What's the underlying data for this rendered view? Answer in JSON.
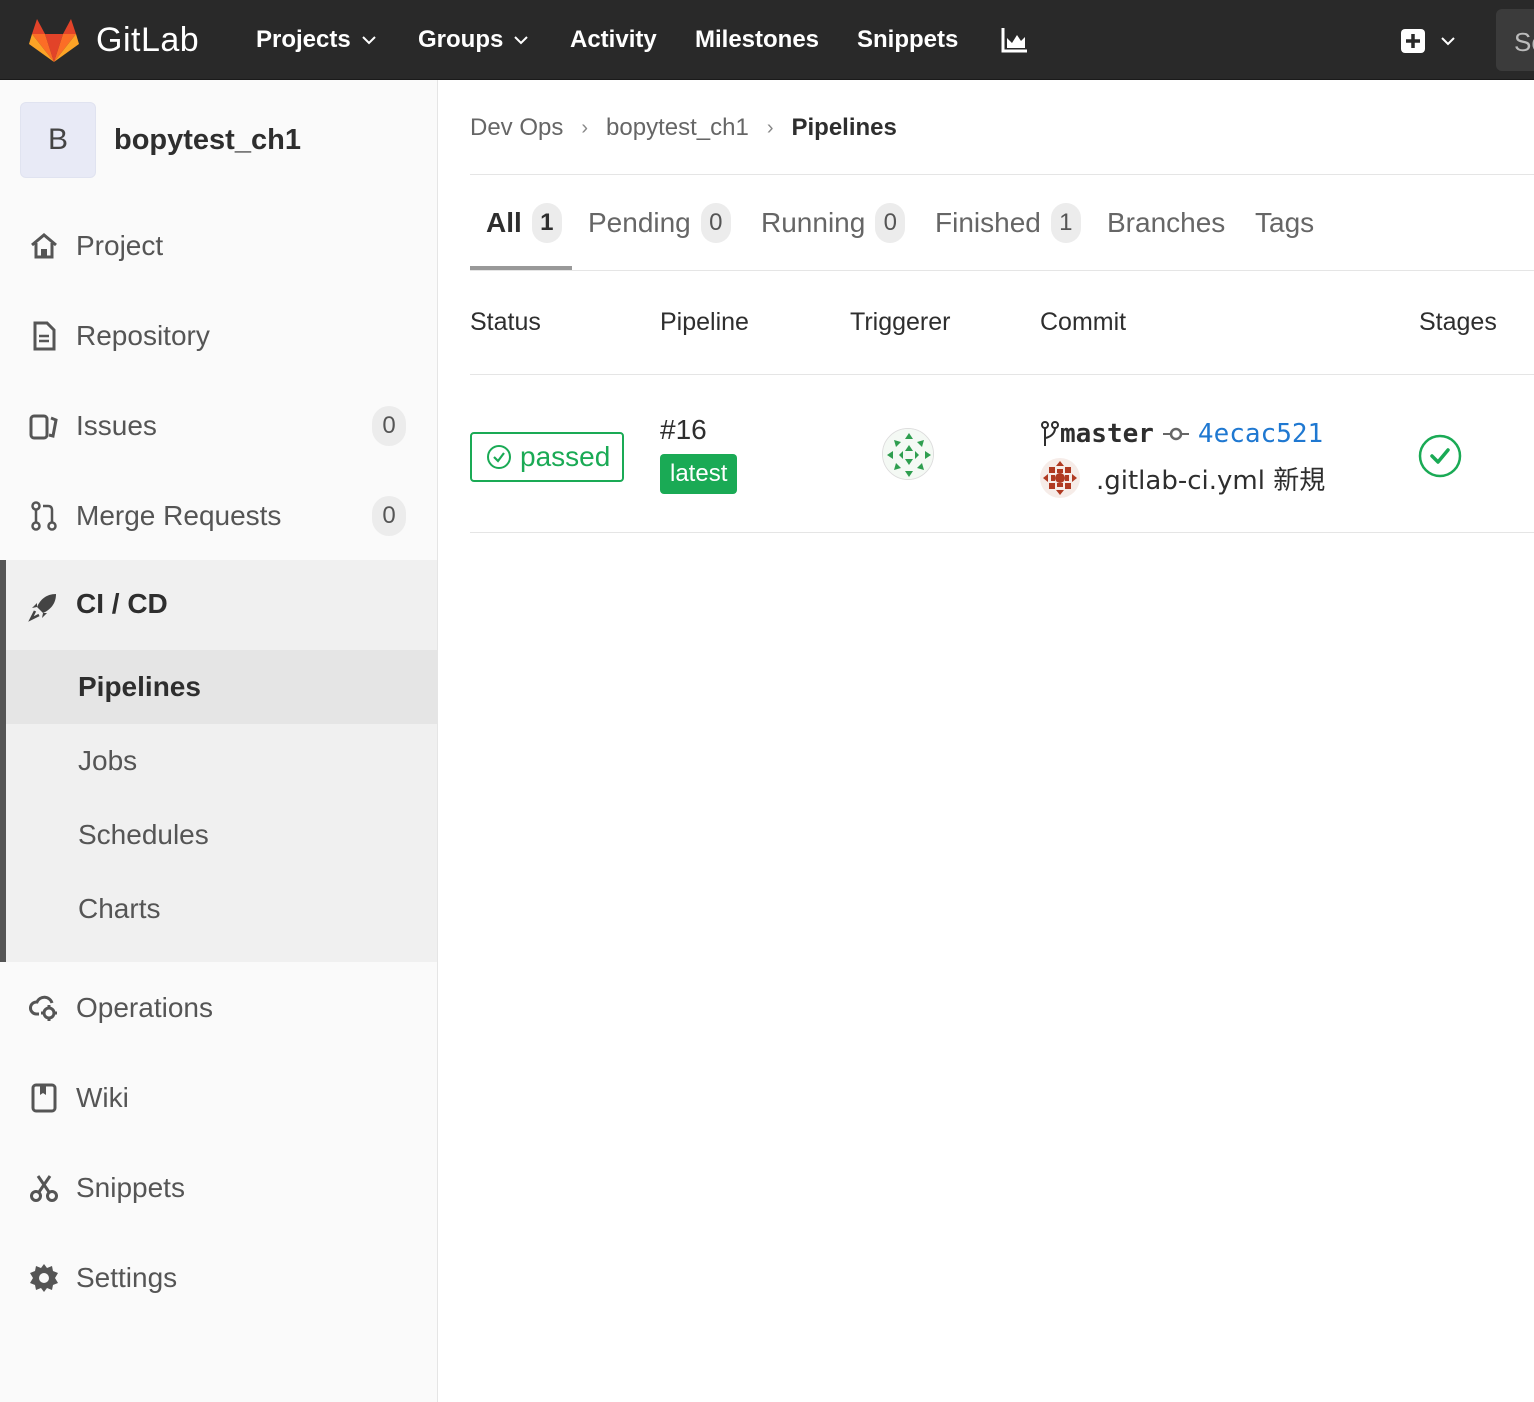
{
  "navbar": {
    "brand": "GitLab",
    "items": [
      {
        "label": "Projects",
        "dropdown": true
      },
      {
        "label": "Groups",
        "dropdown": true
      },
      {
        "label": "Activity"
      },
      {
        "label": "Milestones"
      },
      {
        "label": "Snippets"
      }
    ],
    "search_text": "Se"
  },
  "sidebar": {
    "project_initial": "B",
    "project_name": "bopytest_ch1",
    "items": [
      {
        "label": "Project",
        "icon": "home-icon"
      },
      {
        "label": "Repository",
        "icon": "document-icon"
      },
      {
        "label": "Issues",
        "icon": "issues-icon",
        "count": "0"
      },
      {
        "label": "Merge Requests",
        "icon": "merge-request-icon",
        "count": "0"
      },
      {
        "label": "CI / CD",
        "icon": "rocket-icon"
      },
      {
        "label": "Operations",
        "icon": "cloud-gear-icon"
      },
      {
        "label": "Wiki",
        "icon": "book-icon"
      },
      {
        "label": "Snippets",
        "icon": "scissors-icon"
      },
      {
        "label": "Settings",
        "icon": "gear-icon"
      }
    ],
    "cicd_subitems": [
      "Pipelines",
      "Jobs",
      "Schedules",
      "Charts"
    ],
    "active_subitem": "Pipelines"
  },
  "breadcrumb": [
    "Dev Ops",
    "bopytest_ch1",
    "Pipelines"
  ],
  "tabs": [
    {
      "label": "All",
      "count": "1",
      "active": true
    },
    {
      "label": "Pending",
      "count": "0"
    },
    {
      "label": "Running",
      "count": "0"
    },
    {
      "label": "Finished",
      "count": "1"
    },
    {
      "label": "Branches"
    },
    {
      "label": "Tags"
    }
  ],
  "table": {
    "headers": [
      "Status",
      "Pipeline",
      "Triggerer",
      "Commit",
      "Stages"
    ],
    "rows": [
      {
        "status": "passed",
        "pipeline_id": "#16",
        "pipeline_tag": "latest",
        "branch": "master",
        "sha": "4ecac521",
        "message": ".gitlab-ci.yml 新規",
        "stage_status": "success"
      }
    ]
  },
  "colors": {
    "navbar": "#292929",
    "success": "#1aaa55",
    "link": "#1f78d1"
  }
}
